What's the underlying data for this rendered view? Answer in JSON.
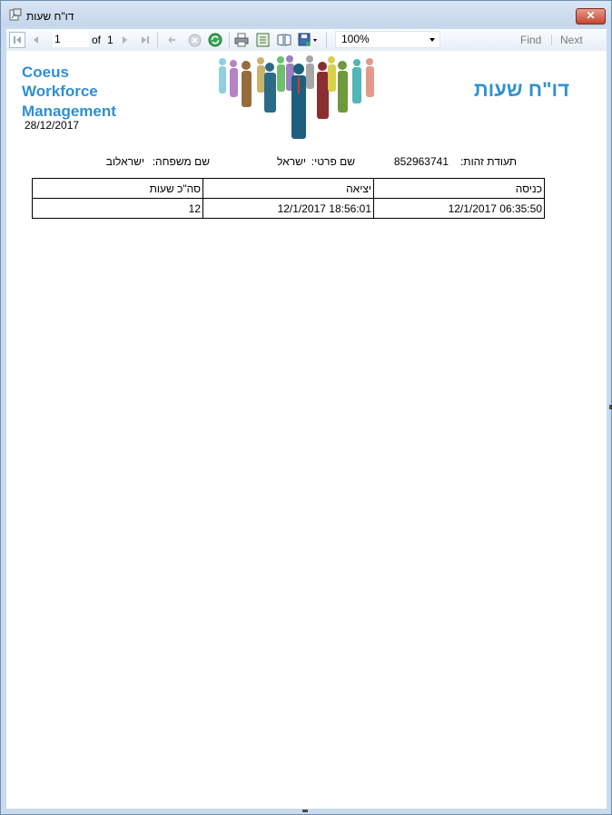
{
  "window": {
    "title": "דו\"ח שעות",
    "close_label": "✕"
  },
  "toolbar": {
    "page_value": "1",
    "of_label": "of",
    "total_pages": "1",
    "zoom_value": "100%",
    "find_label": "Find",
    "next_label": "Next",
    "icons": [
      "first-page-icon",
      "prev-page-icon",
      "next-page-icon",
      "last-page-icon",
      "back-icon",
      "stop-icon",
      "refresh-icon",
      "print-icon",
      "print-layout-icon",
      "page-setup-icon",
      "export-icon"
    ]
  },
  "report": {
    "logo_lines": [
      "Coeus",
      "Workforce",
      "Management"
    ],
    "date": "28/12/2017",
    "title": "דו\"ח שעות",
    "id_label": "תעודת זהות:",
    "id_value": "852963741",
    "first_name_label": "שם פרטי:",
    "first_name_value": "ישראל",
    "last_name_label": "שם משפחה:",
    "last_name_value": "ישראלוב",
    "columns": [
      "כניסה",
      "יציאה",
      "סה\"כ שעות"
    ],
    "rows": [
      [
        "12/1/2017 06:35:50",
        "12/1/2017 18:56:01",
        "12"
      ]
    ]
  },
  "colors": {
    "accent": "#3192cf",
    "frame": "#c9daec"
  }
}
